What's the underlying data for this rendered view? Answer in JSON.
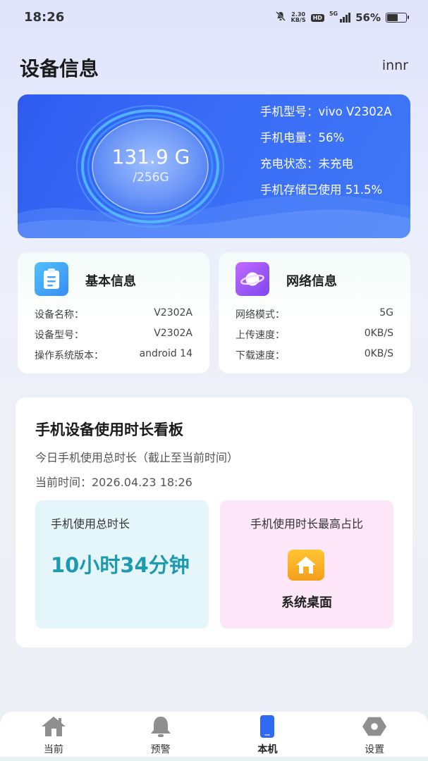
{
  "status_bar": {
    "time": "18:26",
    "speed_value": "2.30",
    "speed_unit": "KB/S",
    "hd": "HD",
    "network": "5G",
    "battery_pct": "56%",
    "battery_level": 0.56
  },
  "header": {
    "title": "设备信息",
    "user": "innr"
  },
  "hero": {
    "storage_used": "131.9 G",
    "storage_total": "/256G",
    "info": [
      "手机型号：vivo V2302A",
      "手机电量：56%",
      "充电状态：未充电",
      "手机存储已使用 51.5%"
    ]
  },
  "basic_card": {
    "title": "基本信息",
    "icon": "clipboard-icon",
    "rows": [
      {
        "label": "设备名称：",
        "value": "V2302A"
      },
      {
        "label": "设备型号：",
        "value": "V2302A"
      },
      {
        "label": "操作系统版本：",
        "value": "android 14"
      }
    ]
  },
  "network_card": {
    "title": "网络信息",
    "icon": "planet-icon",
    "rows": [
      {
        "label": "网络模式：",
        "value": "5G"
      },
      {
        "label": "上传速度：",
        "value": "0KB/S"
      },
      {
        "label": "下载速度：",
        "value": "0KB/S"
      }
    ]
  },
  "usage": {
    "title": "手机设备使用时长看板",
    "subtitle": "今日手机使用总时长（截止至当前时间）",
    "current_time": "当前时间：2026.04.23 18:26",
    "total_label": "手机使用总时长",
    "total_value": "10小时34分钟",
    "top_label": "手机使用时长最高占比",
    "top_app": "系统桌面",
    "top_app_icon": "home-icon"
  },
  "nav": [
    {
      "label": "当前",
      "icon": "home-icon"
    },
    {
      "label": "预警",
      "icon": "bell-icon"
    },
    {
      "label": "本机",
      "icon": "phone-icon"
    },
    {
      "label": "设置",
      "icon": "settings-icon"
    }
  ],
  "colors": {
    "hero_blue": "#3a6cf7",
    "accent_teal": "#1e9ab0",
    "active_nav": "#2f6bf2"
  }
}
